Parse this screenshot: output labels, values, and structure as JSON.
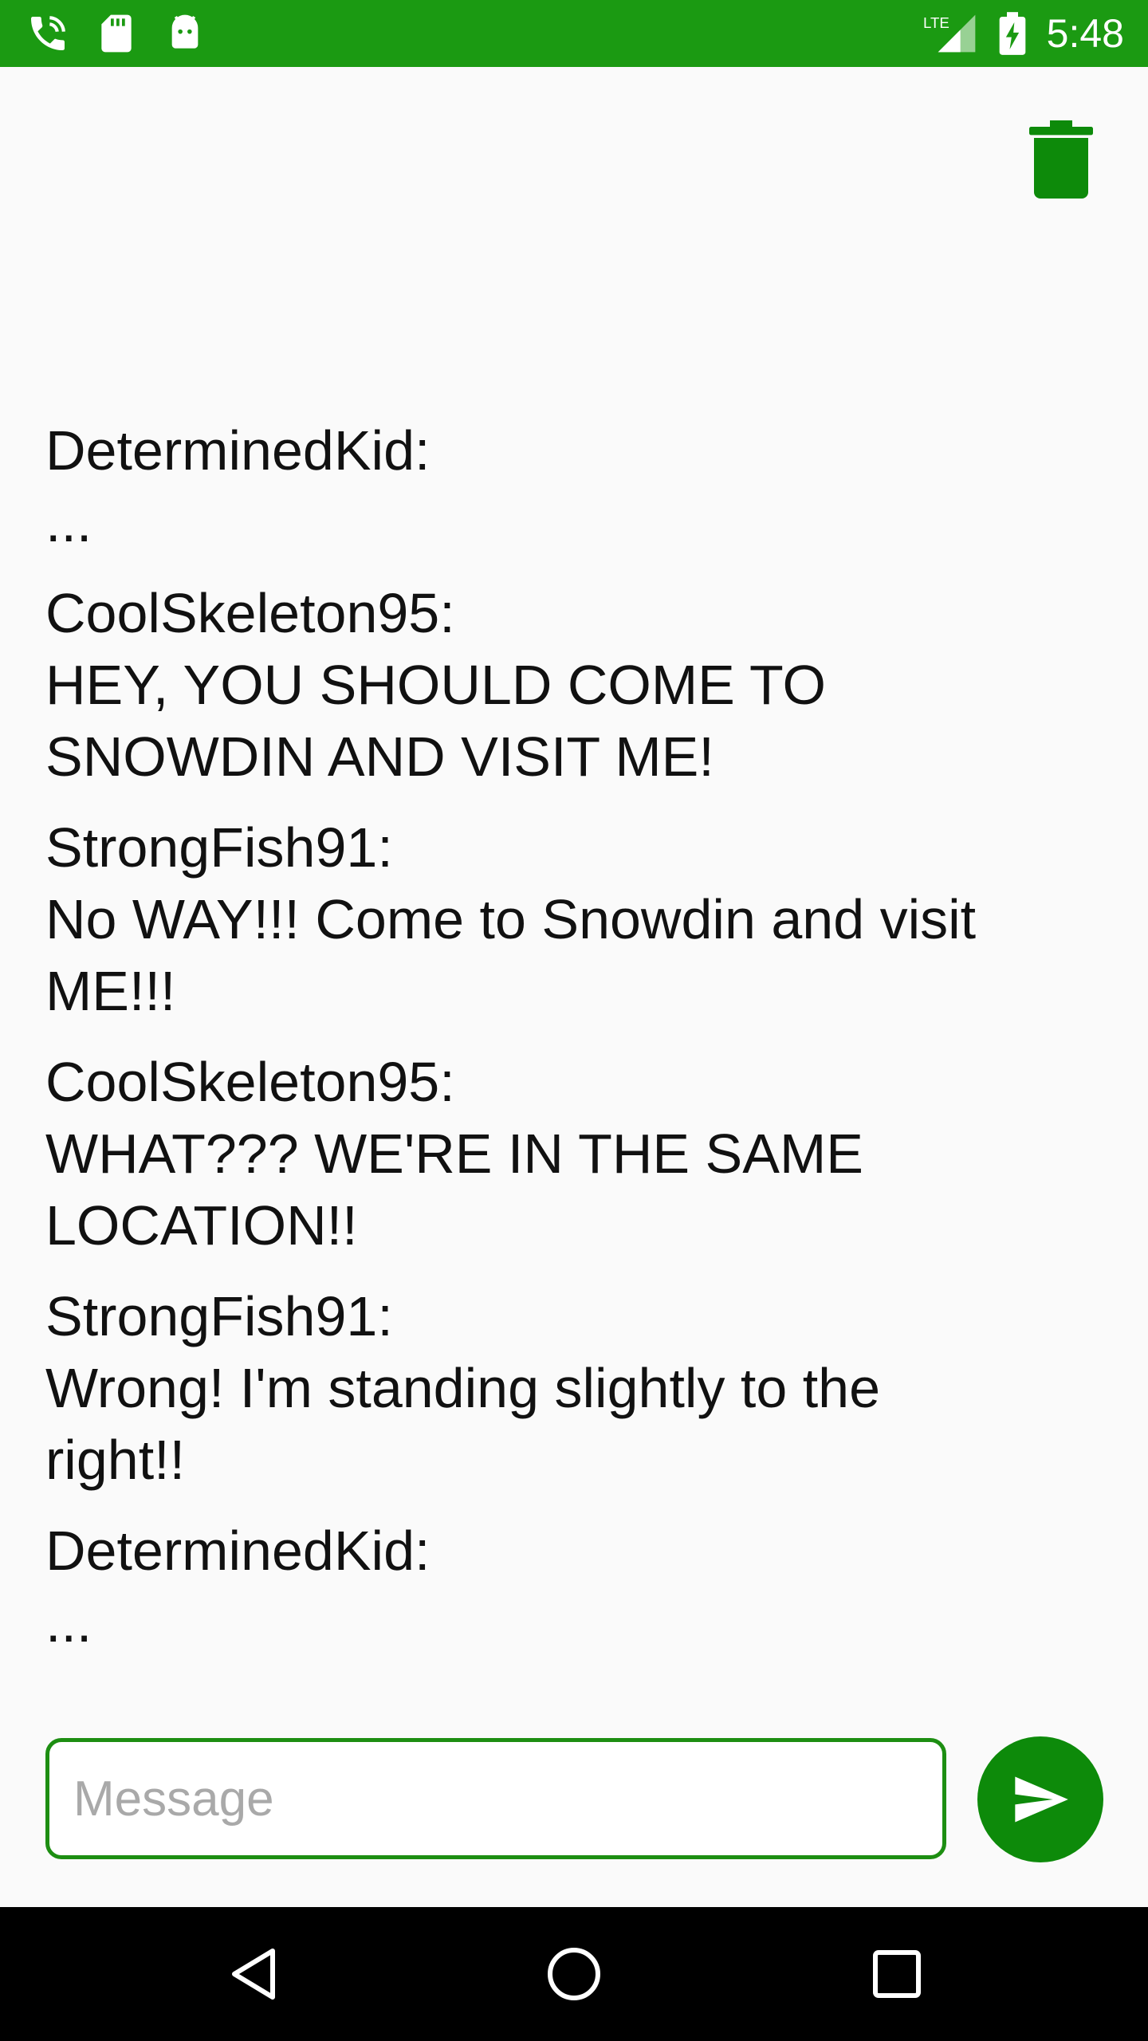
{
  "status_bar": {
    "time": "5:48",
    "network": "LTE",
    "icons": [
      "wifi-calling-icon",
      "sd-card-icon",
      "android-icon",
      "lte-signal-icon",
      "battery-charging-icon"
    ],
    "color": "#1b9a12"
  },
  "toolbar": {
    "delete_icon": "trash-icon",
    "accent": "#0d8a0a"
  },
  "messages": [
    {
      "sender": "DeterminedKid:",
      "text": "..."
    },
    {
      "sender": "CoolSkeleton95:",
      "text": "HEY, YOU SHOULD COME TO\nSNOWDIN AND VISIT ME!"
    },
    {
      "sender": "StrongFish91:",
      "text": "No WAY!!! Come to Snowdin and visit\nME!!!"
    },
    {
      "sender": "CoolSkeleton95:",
      "text": "WHAT??? WE'RE IN THE SAME\nLOCATION!!"
    },
    {
      "sender": "StrongFish91:",
      "text": "Wrong! I'm standing slightly to the\nright!!"
    },
    {
      "sender": "DeterminedKid:",
      "text": "..."
    }
  ],
  "composer": {
    "placeholder": "Message",
    "value": "",
    "send_icon": "send-icon"
  },
  "nav_bar": {
    "buttons": [
      "back-icon",
      "home-icon",
      "recents-icon"
    ]
  }
}
